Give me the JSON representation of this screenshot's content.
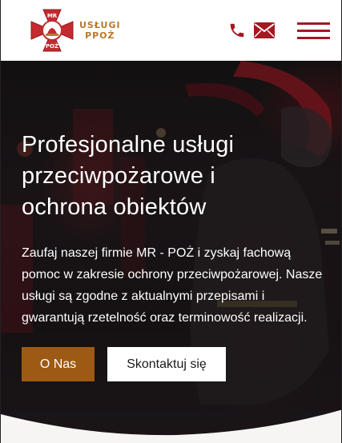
{
  "header": {
    "logo": {
      "badge_text_top": "MR",
      "badge_text_bottom": "POŻ",
      "brand_line1": "USŁUGI",
      "brand_line2": "PPOŻ"
    },
    "icons": {
      "phone": "phone-icon",
      "mail": "mail-icon",
      "menu": "hamburger-menu-icon"
    },
    "accent_color": "#a31822",
    "brand_color": "#b8782a"
  },
  "hero": {
    "title": "Profesjonalne usługi przeciwpożarowe i ochrona obiektów",
    "text": "Zaufaj naszej firmie MR - POŻ i zyskaj fachową pomoc w zakresie ochrony przeciwpożarowej. Nasze usługi są zgodne z aktualnymi przepisami i gwarantują rzetelność oraz terminowość realizacji.",
    "buttons": {
      "about": "O Nas",
      "contact": "Skontaktuj się"
    },
    "button_colors": {
      "about_bg": "#9c5a14",
      "contact_bg": "#ffffff"
    }
  }
}
